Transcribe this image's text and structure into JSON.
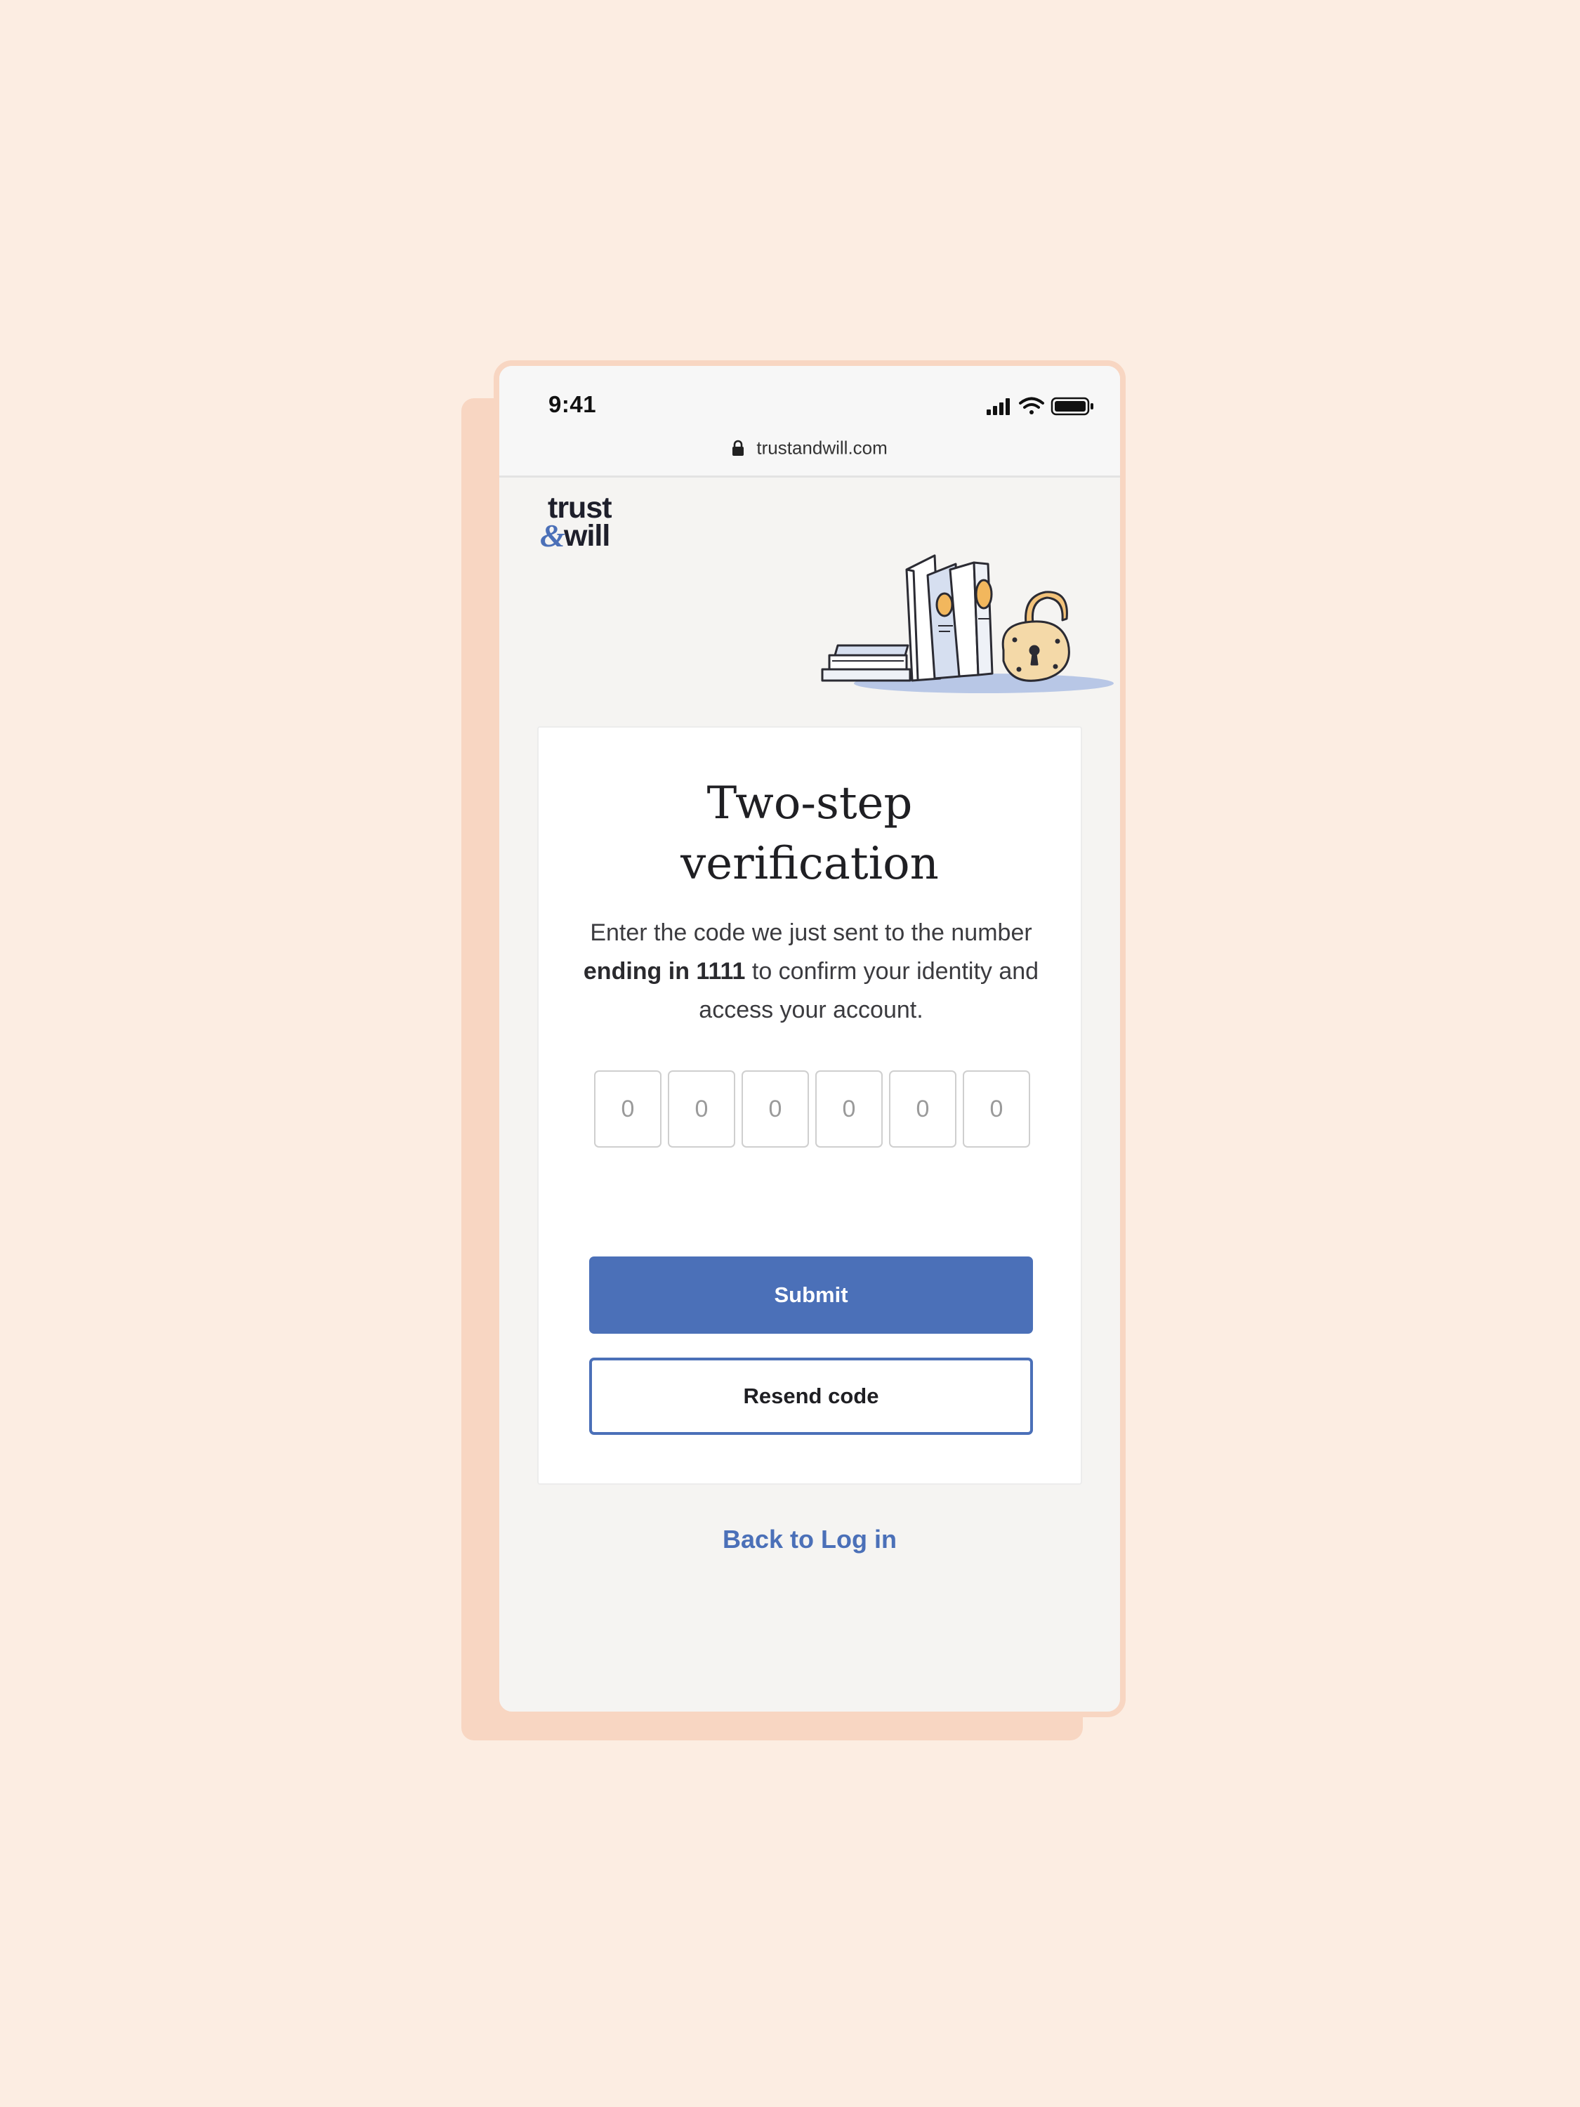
{
  "status_bar": {
    "time": "9:41",
    "url": "trustandwill.com"
  },
  "logo": {
    "line1": "trust",
    "amp": "&",
    "line2": "will"
  },
  "illustration": {
    "icon": "books-and-padlock-illustration"
  },
  "verification": {
    "title_line1": "Two-step",
    "title_line2": "verification",
    "desc_part1": "Enter the code we just sent to the number ",
    "desc_bold": "ending in 1111",
    "desc_part2": " to confirm your identity and access your account.",
    "code_digits": [
      "0",
      "0",
      "0",
      "0",
      "0",
      "0"
    ],
    "submit_label": "Submit",
    "resend_label": "Resend code"
  },
  "footer": {
    "back_link_label": "Back to Log in"
  },
  "colors": {
    "background": "#fcede2",
    "frame": "#f8d6c2",
    "accent": "#4b70b8",
    "surface": "#f5f4f2"
  }
}
